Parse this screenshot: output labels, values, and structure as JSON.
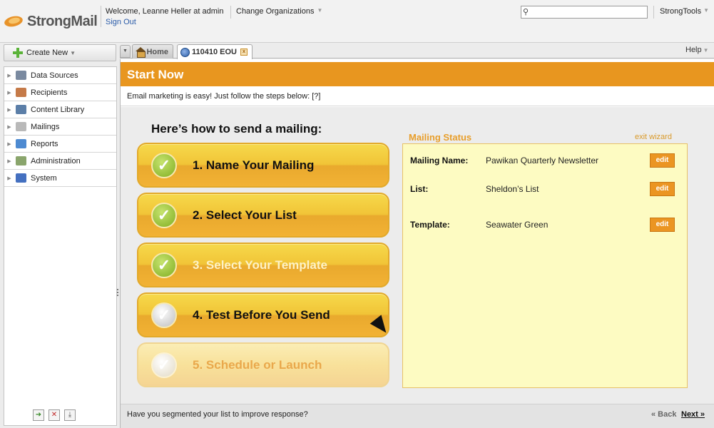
{
  "header": {
    "logo_text": "StrongMail",
    "welcome": "Welcome, Leanne Heller at admin",
    "sign_out": "Sign Out",
    "change_org": "Change Organizations",
    "search_placeholder": "",
    "strongtools": "StrongTools"
  },
  "sidebar": {
    "create_new": "Create New",
    "items": [
      {
        "label": "Data Sources",
        "icon": "database-icon",
        "color": "#7a8aa0"
      },
      {
        "label": "Recipients",
        "icon": "people-icon",
        "color": "#c57a48"
      },
      {
        "label": "Content Library",
        "icon": "documents-icon",
        "color": "#5c7fa8"
      },
      {
        "label": "Mailings",
        "icon": "envelope-icon",
        "color": "#b9b9b9"
      },
      {
        "label": "Reports",
        "icon": "chart-icon",
        "color": "#4d8ad1"
      },
      {
        "label": "Administration",
        "icon": "gear-icon",
        "color": "#8aa56c"
      },
      {
        "label": "System",
        "icon": "computer-icon",
        "color": "#4470c0"
      }
    ]
  },
  "tabs": {
    "home": "Home",
    "mailing": "110410 EOU",
    "help": "Help"
  },
  "panel": {
    "title": "Start Now",
    "intro": "Email marketing is easy! Just follow the steps below: [?]",
    "how_to": "Here’s how to send a mailing:",
    "steps": [
      {
        "label": "1. Name Your Mailing",
        "state": "done"
      },
      {
        "label": "2. Select Your List",
        "state": "done"
      },
      {
        "label": "3. Select Your Template",
        "state": "active"
      },
      {
        "label": "4. Test Before You Send",
        "state": "todo"
      },
      {
        "label": "5. Schedule or Launch",
        "state": "disabled"
      }
    ],
    "status": {
      "heading": "Mailing Status",
      "exit": "exit wizard",
      "rows": [
        {
          "key": "Mailing Name:",
          "value": "Pawikan Quarterly Newsletter",
          "edit": "edit"
        },
        {
          "key": "List:",
          "value": "Sheldon’s List",
          "edit": "edit"
        },
        {
          "key": "Template:",
          "value": "Seawater Green",
          "edit": "edit"
        }
      ]
    },
    "footer": {
      "tip": "Have you segmented your list to improve response?",
      "back": "« Back",
      "next": "Next »"
    }
  },
  "colors": {
    "accent_orange": "#e8961f",
    "status_bg": "#fdfbc2",
    "step_gold": "#f1c437"
  }
}
